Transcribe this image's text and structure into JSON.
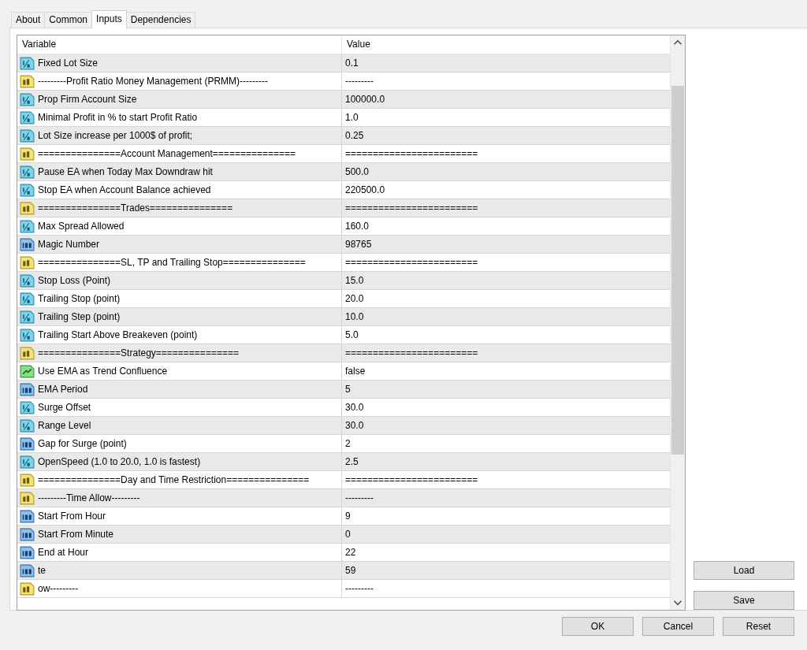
{
  "tabs": [
    {
      "label": "About",
      "selected": false
    },
    {
      "label": "Common",
      "selected": false
    },
    {
      "label": "Inputs",
      "selected": true
    },
    {
      "label": "Dependencies",
      "selected": false
    }
  ],
  "table": {
    "columns": [
      "Variable",
      "Value"
    ],
    "rows": [
      {
        "kind": "double",
        "variable": "Fixed Lot Size",
        "value": "0.1"
      },
      {
        "kind": "string",
        "variable": "---------Profit Ratio Money Management (PRMM)---------",
        "value": "---------"
      },
      {
        "kind": "double",
        "variable": "Prop Firm Account Size",
        "value": "100000.0"
      },
      {
        "kind": "double",
        "variable": "Minimal Profit in % to start Profit Ratio",
        "value": "1.0"
      },
      {
        "kind": "double",
        "variable": "Lot Size increase per 1000$ of profit;",
        "value": "0.25"
      },
      {
        "kind": "string",
        "variable": "===============Account Management===============",
        "value": "========================"
      },
      {
        "kind": "double",
        "variable": "Pause EA when Today Max Downdraw hit",
        "value": "500.0"
      },
      {
        "kind": "double",
        "variable": "Stop EA when Account Balance achieved",
        "value": "220500.0"
      },
      {
        "kind": "string",
        "variable": "===============Trades===============",
        "value": "========================"
      },
      {
        "kind": "double",
        "variable": "Max Spread Allowed",
        "value": "160.0"
      },
      {
        "kind": "int",
        "variable": "Magic Number",
        "value": "98765"
      },
      {
        "kind": "string",
        "variable": "===============SL, TP and Trailing Stop===============",
        "value": "========================"
      },
      {
        "kind": "double",
        "variable": "Stop Loss (Point)",
        "value": "15.0"
      },
      {
        "kind": "double",
        "variable": "Trailing Stop (point)",
        "value": "20.0"
      },
      {
        "kind": "double",
        "variable": "Trailing Step (point)",
        "value": "10.0"
      },
      {
        "kind": "double",
        "variable": "Trailing Start Above Breakeven (point)",
        "value": "5.0"
      },
      {
        "kind": "string",
        "variable": "===============Strategy===============",
        "value": "========================"
      },
      {
        "kind": "bool",
        "variable": "Use EMA as Trend Confluence",
        "value": "false"
      },
      {
        "kind": "int",
        "variable": "EMA Period",
        "value": "5"
      },
      {
        "kind": "double",
        "variable": "Surge Offset",
        "value": "30.0"
      },
      {
        "kind": "double",
        "variable": "Range Level",
        "value": "30.0"
      },
      {
        "kind": "int",
        "variable": "Gap for Surge (point)",
        "value": "2"
      },
      {
        "kind": "double",
        "variable": "OpenSpeed (1.0 to 20.0, 1.0 is fastest)",
        "value": "2.5"
      },
      {
        "kind": "string",
        "variable": "===============Day and Time Restriction===============",
        "value": "========================"
      },
      {
        "kind": "string",
        "variable": "---------Time Allow---------",
        "value": "---------"
      },
      {
        "kind": "int",
        "variable": "Start From Hour",
        "value": "9"
      },
      {
        "kind": "int",
        "variable": "Start From Minute",
        "value": "0"
      },
      {
        "kind": "int",
        "variable": "End at Hour",
        "value": "22"
      },
      {
        "kind": "int",
        "variable": "te",
        "value": "59"
      },
      {
        "kind": "string",
        "variable": "ow---------",
        "value": "---------"
      }
    ]
  },
  "side_buttons": [
    "Load",
    "Save"
  ],
  "buttons": [
    "OK",
    "Cancel",
    "Reset"
  ]
}
